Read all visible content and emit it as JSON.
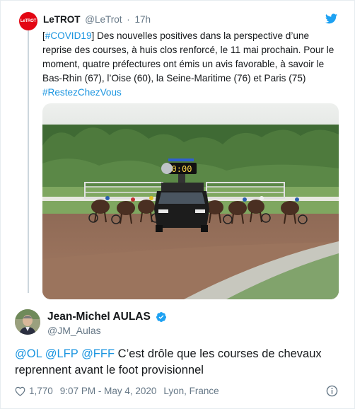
{
  "colors": {
    "link": "#1b95e0",
    "text": "#14171a",
    "muted": "#657786",
    "twitter_blue": "#1da1f2",
    "letrot_red": "#e30613"
  },
  "quoted_tweet": {
    "avatar_text": "LeTROT",
    "author_name": "LeTROT",
    "handle": "@LeTrot",
    "separator": "·",
    "time": "17h",
    "text_parts": {
      "bracket_open": "[",
      "hashtag_covid": "#COVID19",
      "body": "] Des nouvelles positives dans la perspective d’une reprise des courses, à huis clos renforcé, le 11 mai prochain. Pour le moment, quatre préfectures ont émis un avis favorable, à savoir le Bas-Rhin (67), l’Oise (60), la Seine-Maritime (76) et Paris (75)",
      "hashtag_restez": "#RestezChezVous"
    },
    "media": {
      "icon": "photo-harness-racing",
      "clock_display": "0:00"
    },
    "brand_icon": "twitter-bird-icon"
  },
  "main_tweet": {
    "author_name": "Jean-Michel AULAS",
    "verified_icon": "verified-badge-icon",
    "handle": "@JM_Aulas",
    "mentions": [
      "@OL",
      "@LFP",
      "@FFF"
    ],
    "text": "C’est drôle que les courses de chevaux reprennent avant le foot provisionnel",
    "like_count": "1,770",
    "timestamp": "9:07 PM - May 4, 2020",
    "location": "Lyon, France",
    "icons": [
      "heart-icon",
      "info-icon"
    ]
  }
}
